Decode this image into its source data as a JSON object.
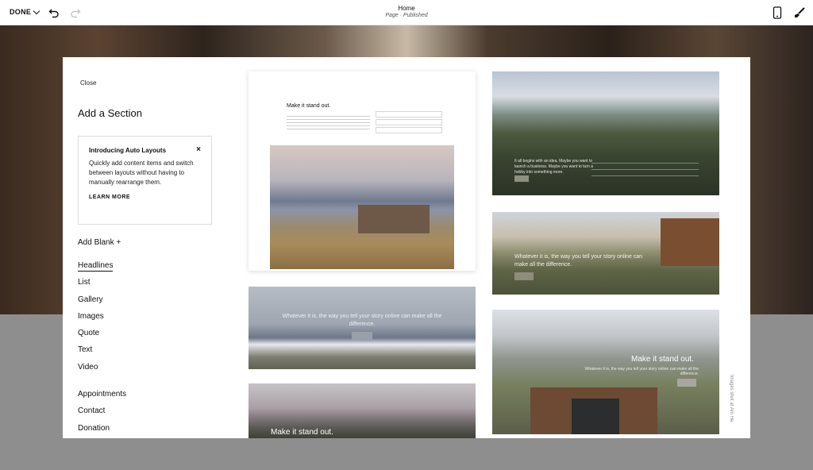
{
  "topbar": {
    "done_label": "DONE",
    "page_title": "Home",
    "page_status": "Page · Published"
  },
  "panel": {
    "close_label": "Close",
    "title": "Add a Section",
    "notice": {
      "title": "Introducing Auto Layouts",
      "close_glyph": "×",
      "body": "Quickly add content items and switch between layouts without having to manually rearrange them.",
      "link": "LEARN MORE"
    },
    "add_blank": "Add Blank +",
    "categories": [
      "Headlines",
      "List",
      "Gallery",
      "Images",
      "Quote",
      "Text",
      "Video"
    ],
    "categories2": [
      "Appointments",
      "Contact",
      "Donation"
    ]
  },
  "previews": {
    "card1_title": "Make it stand out.",
    "card2_text": "Whatever it is, the way you tell your story online can make all the difference.",
    "card3_title": "Make it stand out.",
    "card4_text": "It all begins with an idea. Maybe you want to launch a business. Maybe you want to turn a hobby into something more.",
    "card5_text": "Whatever it is, the way you tell your story online can make all the difference.",
    "card6_title": "Make it stand out.",
    "card6_sub": "Whatever it is, the way you tell your story online can make all the difference.",
    "credit": "Images shot at Aro Ha"
  }
}
